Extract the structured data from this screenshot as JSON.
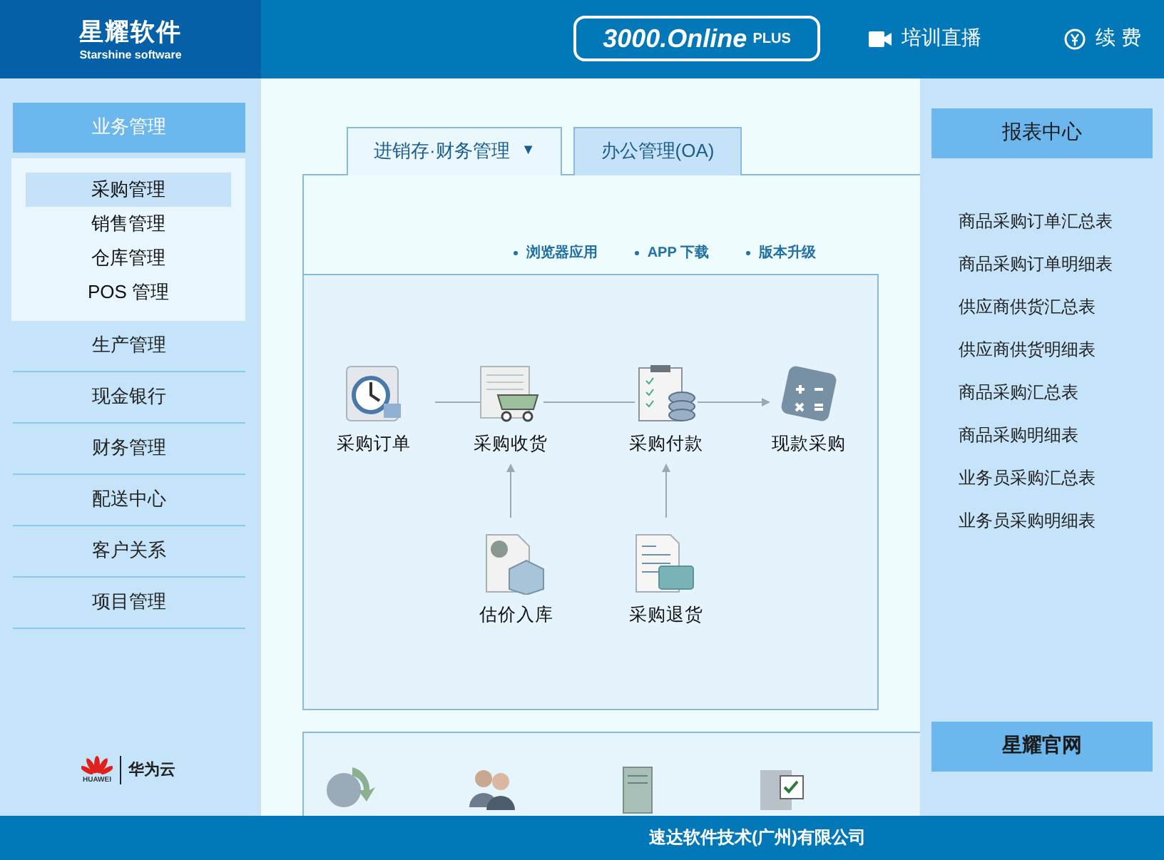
{
  "header": {
    "brand": {
      "name": "星耀软件",
      "subtitle": "Starshine software"
    },
    "product": {
      "name": "3000.Online",
      "suffix": "PLUS"
    },
    "links": [
      {
        "kind": "video",
        "label": "培训直播"
      },
      {
        "kind": "renew",
        "label": "续 费"
      }
    ]
  },
  "sidebar": {
    "items": [
      {
        "label": "业务管理",
        "expanded": true,
        "children": [
          {
            "label": "采购管理",
            "selected": true
          },
          {
            "label": "销售管理",
            "selected": false
          },
          {
            "label": "仓库管理",
            "selected": false
          },
          {
            "label": "POS 管理",
            "selected": false
          }
        ]
      },
      {
        "label": "生产管理",
        "expanded": false
      },
      {
        "label": "现金银行",
        "expanded": false
      },
      {
        "label": "财务管理",
        "expanded": false
      },
      {
        "label": "配送中心",
        "expanded": false
      },
      {
        "label": "客户关系",
        "expanded": false
      },
      {
        "label": "项目管理",
        "expanded": false
      }
    ],
    "partner": {
      "caption": "HUAWEI",
      "name": "华为云"
    }
  },
  "tabs": [
    {
      "label": "进销存·财务管理",
      "caret": "▼",
      "selected": true
    },
    {
      "label": "办公管理(OA)",
      "selected": false
    }
  ],
  "quick_links": [
    "浏览器应用",
    "APP 下载",
    "版本升级"
  ],
  "flow": {
    "nodes": [
      {
        "kind": "order",
        "label": "采购订单"
      },
      {
        "kind": "receive",
        "label": "采购收货"
      },
      {
        "kind": "pay",
        "label": "采购付款"
      },
      {
        "kind": "cash",
        "label": "现款采购"
      },
      {
        "kind": "estimate",
        "label": "估价入库"
      },
      {
        "kind": "return",
        "label": "采购退货"
      }
    ]
  },
  "reports": {
    "title": "报表中心",
    "items": [
      "商品采购订单汇总表",
      "商品采购订单明细表",
      "供应商供货汇总表",
      "供应商供货明细表",
      "商品采购汇总表",
      "商品采购明细表",
      "业务员采购汇总表",
      "业务员采购明细表"
    ],
    "site_button": "星耀官网"
  },
  "footer": {
    "company": "速达软件技术(广州)有限公司"
  }
}
